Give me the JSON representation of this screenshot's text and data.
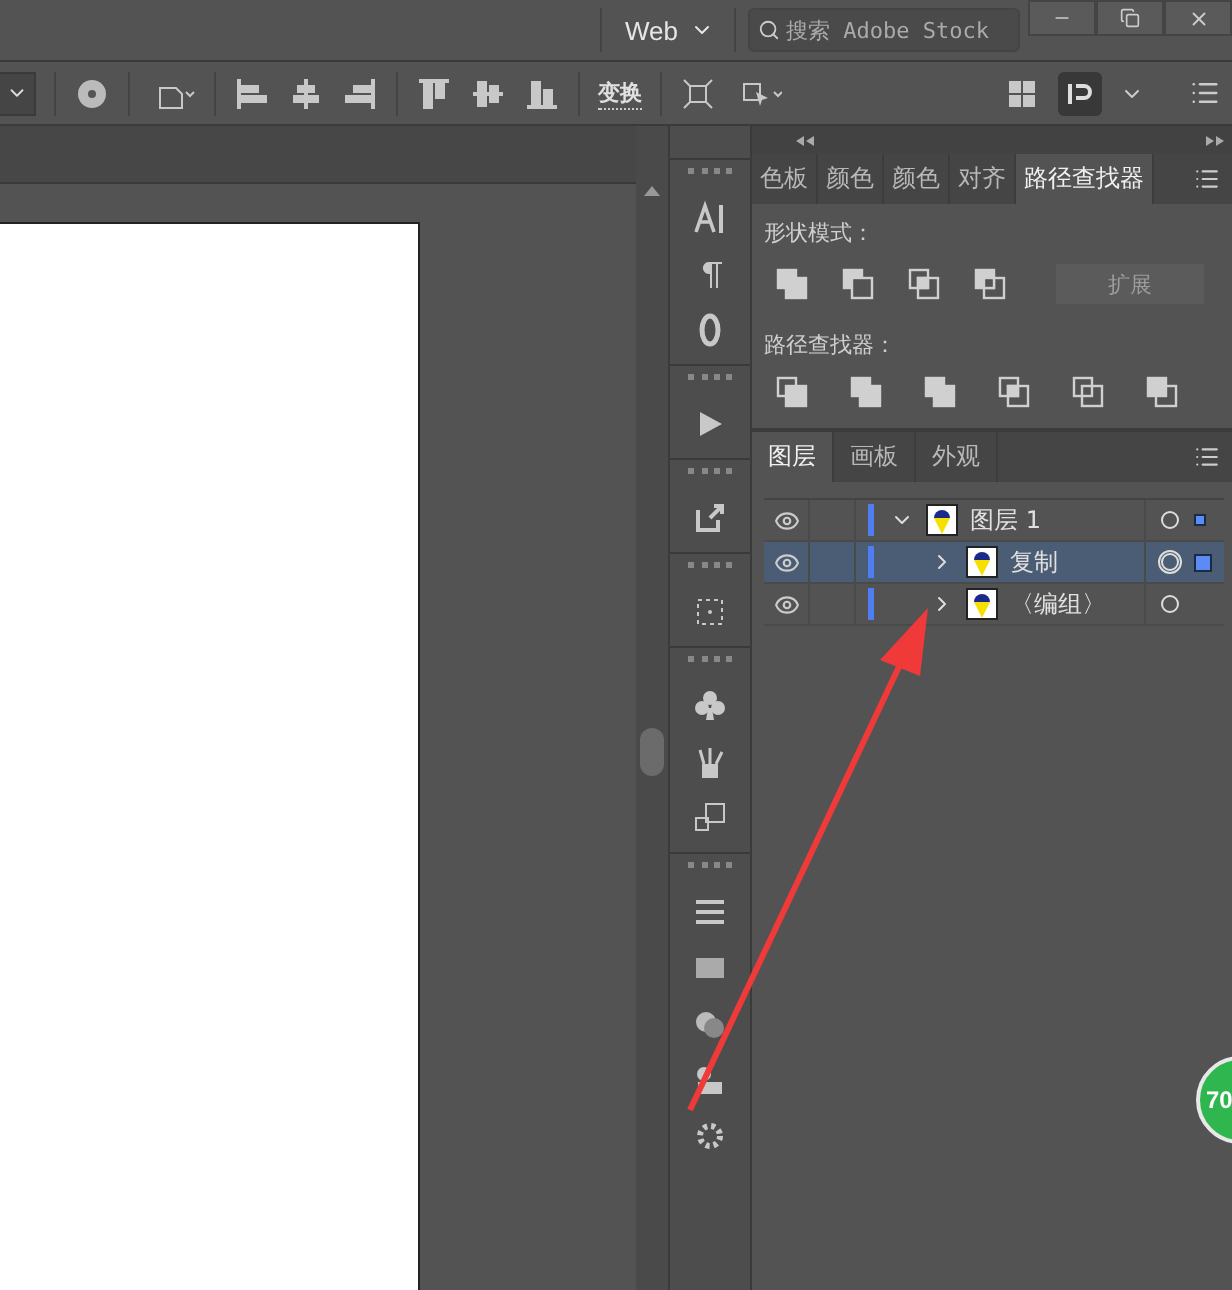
{
  "workspace": {
    "label": "Web"
  },
  "search": {
    "placeholder": "搜索 Adobe Stock"
  },
  "toolbar": {
    "transform_label": "变换"
  },
  "pathfinder_panel": {
    "tabs": [
      {
        "label": "色板",
        "selected": false
      },
      {
        "label": "颜色",
        "selected": false
      },
      {
        "label": "颜色",
        "selected": false
      },
      {
        "label": "对齐",
        "selected": false
      },
      {
        "label": "路径查找器",
        "selected": true
      }
    ],
    "shape_modes_label": "形状模式：",
    "expand_button": {
      "label": "扩展",
      "disabled": true
    },
    "pathfinders_label": "路径查找器："
  },
  "layers_panel": {
    "tabs": [
      {
        "label": "图层",
        "selected": true
      },
      {
        "label": "画板",
        "selected": false
      },
      {
        "label": "外观",
        "selected": false
      }
    ],
    "layers": [
      {
        "name": "图层 1",
        "expanded": true,
        "selected": false,
        "targeted": false,
        "contains_selection": true,
        "children": [
          {
            "name": "复制",
            "expanded": false,
            "selected": true,
            "targeted": true
          },
          {
            "name": "〈编组〉",
            "expanded": false,
            "selected": false,
            "targeted": false,
            "contains_selection": false
          }
        ]
      }
    ]
  },
  "badge": {
    "text": "70"
  }
}
